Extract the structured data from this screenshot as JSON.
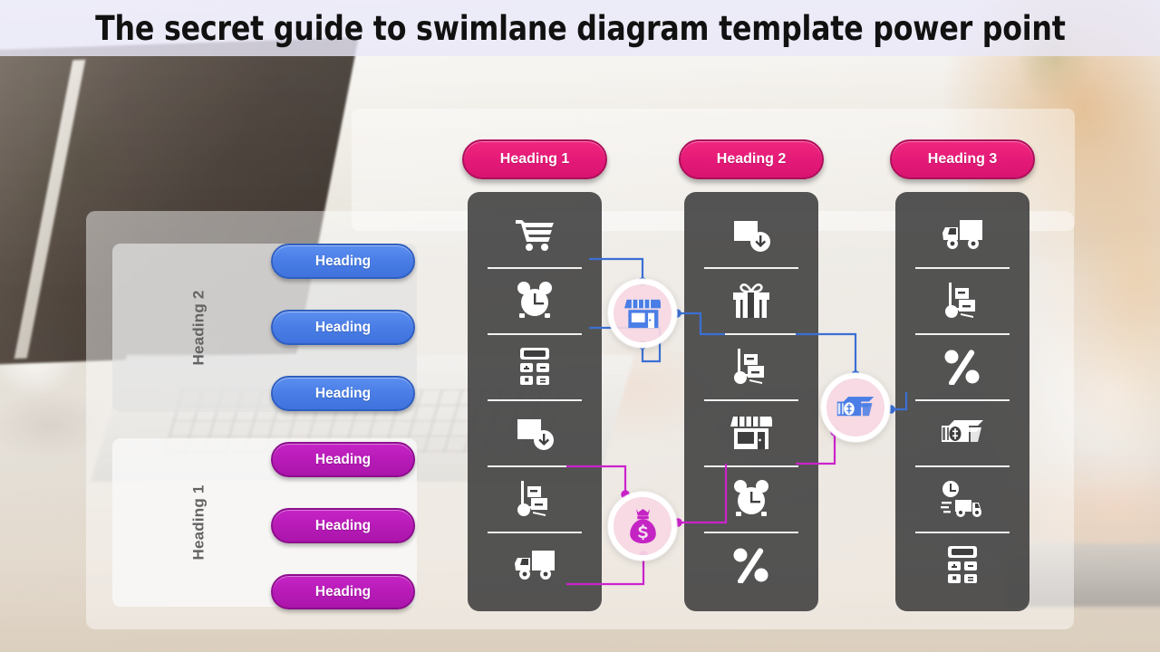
{
  "title": "The secret guide to swimlane diagram template power point",
  "colors": {
    "title_bar_bg": "#e9e7f8",
    "pink": "#e51a78",
    "blue": "#4a7ee6",
    "magenta": "#b81bb8",
    "column_dark": "#3e3e3e",
    "node_fill": "#f7d8e3",
    "wire_blue": "#3b6fd4",
    "wire_magenta": "#cc22cc"
  },
  "column_headers": [
    {
      "label": "Heading 1"
    },
    {
      "label": "Heading 2"
    },
    {
      "label": "Heading 3"
    }
  ],
  "swimlanes": [
    {
      "lane_label": "Heading 2",
      "style": "blue",
      "items": [
        {
          "label": "Heading"
        },
        {
          "label": "Heading"
        },
        {
          "label": "Heading"
        }
      ]
    },
    {
      "lane_label": "Heading 1",
      "style": "magenta",
      "items": [
        {
          "label": "Heading"
        },
        {
          "label": "Heading"
        },
        {
          "label": "Heading"
        }
      ]
    }
  ],
  "icon_columns": [
    {
      "header": "Heading 1",
      "icons": [
        "shopping-cart-icon",
        "alarm-clock-icon",
        "calculator-icon",
        "box-download-icon",
        "hand-truck-icon",
        "delivery-truck-icon"
      ]
    },
    {
      "header": "Heading 2",
      "icons": [
        "box-download-icon",
        "gift-icon",
        "hand-truck-icon",
        "storefront-icon",
        "alarm-clock-icon",
        "percent-icon"
      ]
    },
    {
      "header": "Heading 3",
      "icons": [
        "delivery-truck-icon",
        "hand-truck-icon",
        "percent-icon",
        "cash-stack-icon",
        "express-delivery-icon",
        "calculator-icon"
      ]
    }
  ],
  "nodes": [
    {
      "name": "storefront-node",
      "icon": "storefront-icon",
      "accent": "blue"
    },
    {
      "name": "money-bag-node",
      "icon": "money-bag-icon",
      "accent": "magenta"
    },
    {
      "name": "cash-stack-node",
      "icon": "cash-stack-icon",
      "accent": "blue"
    }
  ]
}
